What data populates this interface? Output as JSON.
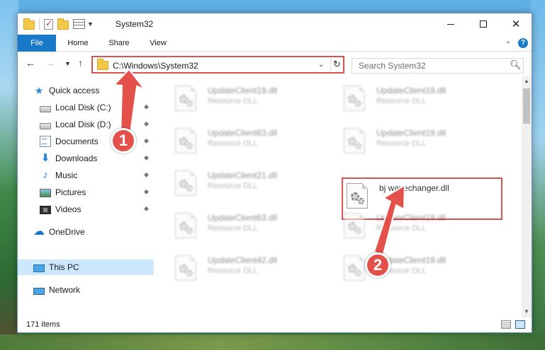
{
  "window": {
    "title": "System32",
    "controls": {
      "minimize": "—",
      "maximize": "□",
      "close": "✕"
    }
  },
  "ribbon": {
    "tabs": [
      "File",
      "Home",
      "Share",
      "View"
    ],
    "help": "?"
  },
  "navigation": {
    "back": "←",
    "forward": "→",
    "recent": "⌄",
    "up": "↑",
    "address": "C:\\Windows\\System32",
    "refresh": "↻",
    "search_placeholder": "Search System32",
    "search_icon": "⚲"
  },
  "sidebar": {
    "items": [
      {
        "label": "Quick access",
        "icon": "star-icon",
        "pinned": false
      },
      {
        "label": "Local Disk (C:)",
        "icon": "disk-icon",
        "pinned": true
      },
      {
        "label": "Local Disk (D:)",
        "icon": "disk-icon",
        "pinned": true
      },
      {
        "label": "Documents",
        "icon": "document-icon",
        "pinned": true
      },
      {
        "label": "Downloads",
        "icon": "download-icon",
        "pinned": true
      },
      {
        "label": "Music",
        "icon": "music-icon",
        "pinned": true
      },
      {
        "label": "Pictures",
        "icon": "pictures-icon",
        "pinned": true
      },
      {
        "label": "Videos",
        "icon": "videos-icon",
        "pinned": true
      },
      {
        "label": "OneDrive",
        "icon": "onedrive-icon",
        "pinned": false
      },
      {
        "label": "This PC",
        "icon": "this-pc-icon",
        "pinned": false,
        "selected": true
      },
      {
        "label": "Network",
        "icon": "network-icon",
        "pinned": false
      }
    ],
    "pin_glyph": "📌"
  },
  "files": [
    {
      "name": "UpdateClient19.dll",
      "type": "Resource DLL"
    },
    {
      "name": "UpdateClient19.dll",
      "type": "Resource DLL"
    },
    {
      "name": "UpdateClient63.dll",
      "type": "Resource DLL"
    },
    {
      "name": "UpdateClient19.dll",
      "type": "Resource DLL"
    },
    {
      "name": "UpdateClient21.dll",
      "type": "Resource DLL"
    },
    {
      "name": "bj wavechanger.dll",
      "type": ""
    },
    {
      "name": "UpdateClient63.dll",
      "type": "Resource DLL"
    },
    {
      "name": "UpdateClient19.dll",
      "type": "Resource DLL"
    },
    {
      "name": "UpdateClient42.dll",
      "type": "Resource DLL"
    },
    {
      "name": "UpdateClient19.dll",
      "type": "Resource DLL"
    }
  ],
  "status": {
    "item_count": "171 items"
  },
  "annotations": {
    "step1": "1",
    "step2": "2",
    "color": "#e3514a"
  }
}
